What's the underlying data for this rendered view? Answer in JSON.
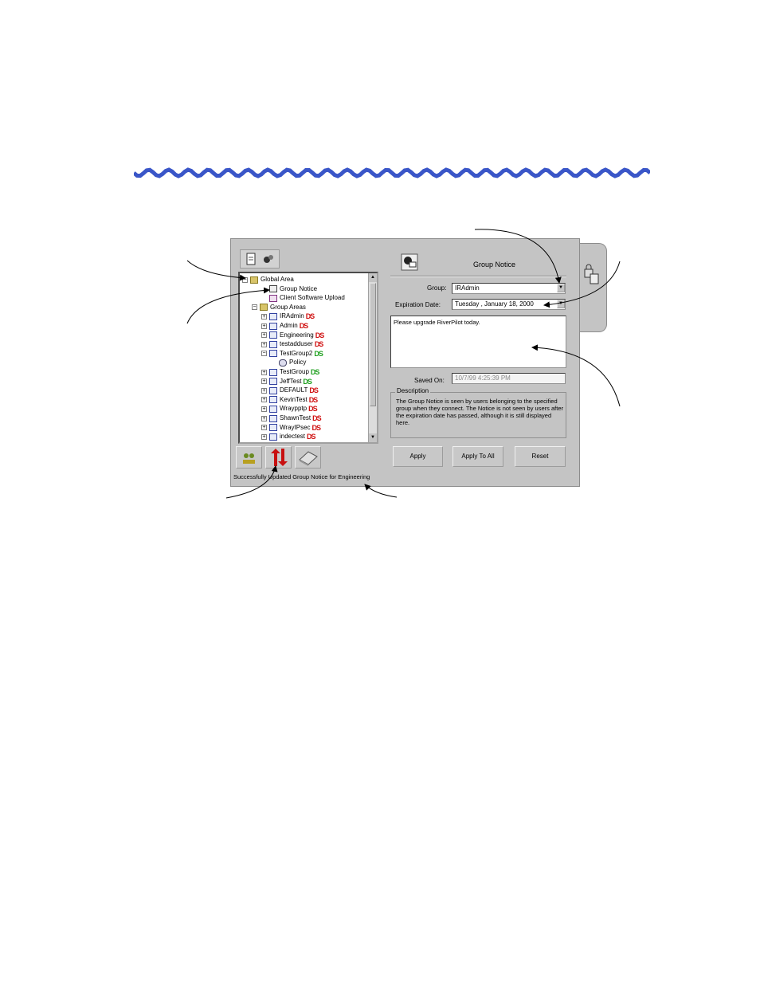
{
  "tree": {
    "nodes": [
      {
        "label": "Global Area",
        "exp": "−",
        "icon": "folder-icon",
        "ds": ""
      },
      {
        "label": "Group Notice",
        "exp": "",
        "icon": "notice-icon",
        "ds": ""
      },
      {
        "label": "Client Software Upload",
        "exp": "",
        "icon": "upload-icon",
        "ds": ""
      },
      {
        "label": "Group Areas",
        "exp": "−",
        "icon": "folder-icon",
        "ds": ""
      },
      {
        "label": "IRAdmin",
        "exp": "+",
        "icon": "group-icon",
        "ds": "DS",
        "ds_color": "red"
      },
      {
        "label": "Admin",
        "exp": "+",
        "icon": "group-icon",
        "ds": "DS",
        "ds_color": "red"
      },
      {
        "label": "Engineering",
        "exp": "+",
        "icon": "group-icon",
        "ds": "DS",
        "ds_color": "red"
      },
      {
        "label": "testadduser",
        "exp": "+",
        "icon": "group-icon",
        "ds": "DS",
        "ds_color": "red"
      },
      {
        "label": "TestGroup2",
        "exp": "−",
        "icon": "group-icon",
        "ds": "DS",
        "ds_color": "green"
      },
      {
        "label": "Policy",
        "exp": "",
        "icon": "policy-icon",
        "ds": ""
      },
      {
        "label": "TestGroup",
        "exp": "+",
        "icon": "group-icon",
        "ds": "DS",
        "ds_color": "green"
      },
      {
        "label": "JeffTest",
        "exp": "+",
        "icon": "group-icon",
        "ds": "DS",
        "ds_color": "green"
      },
      {
        "label": "DEFAULT",
        "exp": "+",
        "icon": "group-icon",
        "ds": "DS",
        "ds_color": "red"
      },
      {
        "label": "KevinTest",
        "exp": "+",
        "icon": "group-icon",
        "ds": "DS",
        "ds_color": "red"
      },
      {
        "label": "Wraypptp",
        "exp": "+",
        "icon": "group-icon",
        "ds": "DS",
        "ds_color": "red"
      },
      {
        "label": "ShawnTest",
        "exp": "+",
        "icon": "group-icon",
        "ds": "DS",
        "ds_color": "red"
      },
      {
        "label": "WrayIPsec",
        "exp": "+",
        "icon": "group-icon",
        "ds": "DS",
        "ds_color": "red"
      },
      {
        "label": "indectest",
        "exp": "+",
        "icon": "group-icon",
        "ds": "DS",
        "ds_color": "red"
      }
    ]
  },
  "status_bar": {
    "text": "Successfully Updated Group Notice for Engineering"
  },
  "panel": {
    "title": "Group Notice",
    "group_label": "Group:",
    "group_value": "IRAdmin",
    "expiration_label": "Expiration Date:",
    "expiration_value": "Tuesday  ,  January  18, 2000",
    "message": "Please upgrade RiverPilot today.",
    "saved_label": "Saved On:",
    "saved_value": "10/7/99 4:25:39 PM",
    "description_label": "Description",
    "description_text": "The Group Notice is seen by users belonging to the specified group when they connect.  The Notice is not seen by users after the expiration date has passed, although it is still displayed here."
  },
  "buttons": {
    "apply": "Apply",
    "apply_all": "Apply To All",
    "reset": "Reset"
  },
  "colors": {
    "wave": "#3a56c8",
    "window_bg": "#c4c4c4",
    "ds_red": "#d01010",
    "ds_green": "#20a020"
  }
}
